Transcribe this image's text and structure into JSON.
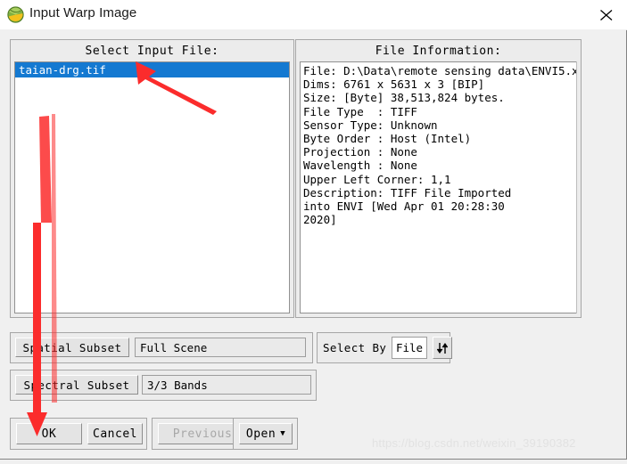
{
  "window": {
    "title": "Input Warp Image",
    "icon": "envi-globe-icon",
    "close_label": "✕"
  },
  "select_input_file": {
    "title": "Select Input File:",
    "items": [
      {
        "label": "taian-drg.tif",
        "selected": true
      }
    ]
  },
  "file_information": {
    "title": "File Information:",
    "lines": [
      "File: D:\\Data\\remote sensing data\\ENVI5.x",
      "Dims: 6761 x 5631 x 3 [BIP]",
      "Size: [Byte] 38,513,824 bytes.",
      "File Type  : TIFF",
      "Sensor Type: Unknown",
      "Byte Order : Host (Intel)",
      "Projection : None",
      "Wavelength : None",
      "Upper Left Corner: 1,1",
      "Description: TIFF File Imported",
      "into ENVI [Wed Apr 01 20:28:30",
      "2020]"
    ]
  },
  "spatial_subset": {
    "button_label": "Spatial Subset",
    "value": "Full Scene"
  },
  "spectral_subset": {
    "button_label": "Spectral Subset",
    "value": "3/3 Bands"
  },
  "select_by": {
    "label": "Select By",
    "value": "File",
    "toggle_icon": "up-down-arrows-icon",
    "toggle_glyph": "⇅"
  },
  "buttons": {
    "ok": "OK",
    "cancel": "Cancel",
    "previous": "Previous",
    "open": "Open",
    "open_caret": "▼"
  },
  "watermark": {
    "text": "https://blog.csdn.net/weixin_39190382"
  },
  "annotations": {
    "arrow_color": "#fb2c2c",
    "arrow_to_file_item": "short-arrow-pointing-to-selected-file",
    "arrow_to_ok_button": "long-arrow-pointing-to-ok-button"
  },
  "colors": {
    "selection_blue": "#1479d1",
    "dialog_gray": "#f0f0f0",
    "panel_gray": "#ececec",
    "titlebar_white": "#ffffff"
  }
}
